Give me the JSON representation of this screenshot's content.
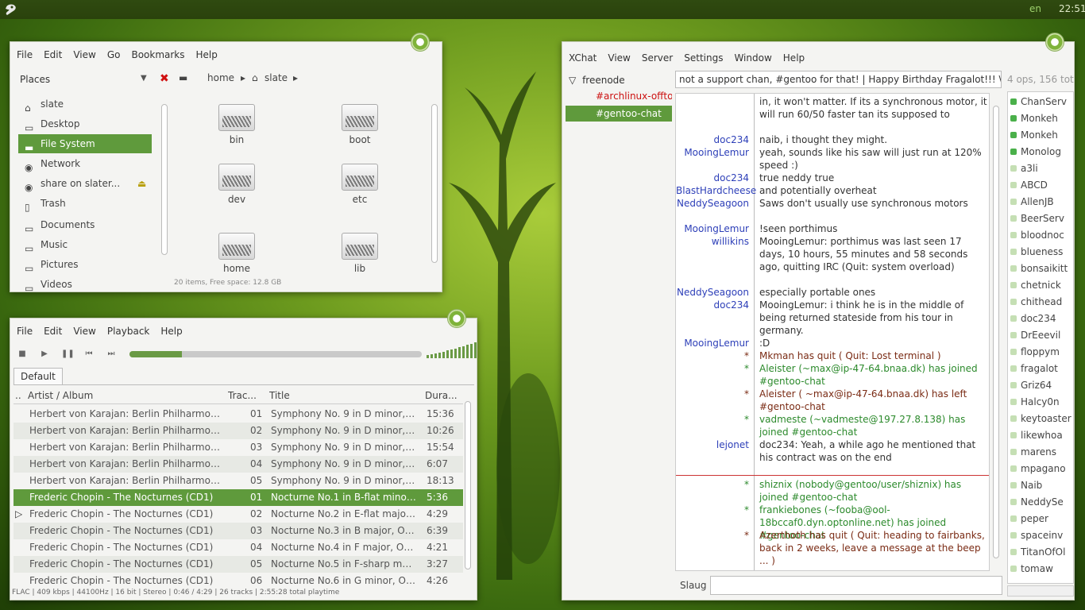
{
  "topbar": {
    "lang": "en",
    "clock": "22:51"
  },
  "file_manager": {
    "menu": [
      "File",
      "Edit",
      "View",
      "Go",
      "Bookmarks",
      "Help"
    ],
    "places_label": "Places",
    "places": [
      {
        "label": "slate",
        "icon": "home-icon"
      },
      {
        "label": "Desktop",
        "icon": "desktop-icon"
      },
      {
        "label": "File System",
        "icon": "drive-icon"
      },
      {
        "label": "Network",
        "icon": "network-icon"
      },
      {
        "label": "share on slater...",
        "icon": "network-share-icon"
      },
      {
        "label": "Trash",
        "icon": "trash-icon"
      },
      {
        "label": "Documents",
        "icon": "folder-icon"
      },
      {
        "label": "Music",
        "icon": "folder-icon"
      },
      {
        "label": "Pictures",
        "icon": "folder-icon"
      },
      {
        "label": "Videos",
        "icon": "folder-icon"
      }
    ],
    "breadcrumb": [
      "home",
      "slate"
    ],
    "folders": [
      "bin",
      "boot",
      "dev",
      "etc",
      "home",
      "lib"
    ],
    "status": "20 items, Free space: 12.8 GB"
  },
  "player": {
    "menu": [
      "File",
      "Edit",
      "View",
      "Playback",
      "Help"
    ],
    "progress": 0.18,
    "tab": "Default",
    "columns": {
      "artist": "Artist / Album",
      "track": "Trac...",
      "title": "Title",
      "duration": "Dura..."
    },
    "rows": [
      {
        "artist": "Herbert von Karajan: Berlin Philharmonic ...",
        "track": "01",
        "title": "Symphony No. 9 in D minor, O...",
        "duration": "15:36"
      },
      {
        "artist": "Herbert von Karajan: Berlin Philharmonic ...",
        "track": "02",
        "title": "Symphony No. 9 in D minor, O...",
        "duration": "10:26"
      },
      {
        "artist": "Herbert von Karajan: Berlin Philharmonic ...",
        "track": "03",
        "title": "Symphony No. 9 in D minor, O...",
        "duration": "15:54"
      },
      {
        "artist": "Herbert von Karajan: Berlin Philharmonic ...",
        "track": "04",
        "title": "Symphony No. 9 in D minor, O...",
        "duration": "6:07"
      },
      {
        "artist": "Herbert von Karajan: Berlin Philharmonic ...",
        "track": "05",
        "title": "Symphony No. 9 in D minor, O...",
        "duration": "18:13"
      },
      {
        "artist": "Frederic Chopin - The Nocturnes (CD1)",
        "track": "01",
        "title": "Nocturne No.1 in B-flat minor, ...",
        "duration": "5:36"
      },
      {
        "artist": "Frederic Chopin - The Nocturnes (CD1)",
        "track": "02",
        "title": "Nocturne No.2 in E-flat major, ...",
        "duration": "4:29"
      },
      {
        "artist": "Frederic Chopin - The Nocturnes (CD1)",
        "track": "03",
        "title": "Nocturne No.3 in B major, Op....",
        "duration": "6:39"
      },
      {
        "artist": "Frederic Chopin - The Nocturnes (CD1)",
        "track": "04",
        "title": "Nocturne No.4 in F major, Op....",
        "duration": "4:21"
      },
      {
        "artist": "Frederic Chopin - The Nocturnes (CD1)",
        "track": "05",
        "title": "Nocturne No.5 in F-sharp maj...",
        "duration": "3:27"
      },
      {
        "artist": "Frederic Chopin - The Nocturnes (CD1)",
        "track": "06",
        "title": "Nocturne No.6 in G minor, Op....",
        "duration": "4:26"
      }
    ],
    "status": "FLAC | 409 kbps | 44100Hz | 16 bit | Stereo | 0:46 / 4:29 | 26 tracks | 2:55:28 total playtime"
  },
  "xchat": {
    "menu": [
      "XChat",
      "View",
      "Server",
      "Settings",
      "Window",
      "Help"
    ],
    "network": "freenode",
    "channels": [
      "#archlinux-offto",
      "#gentoo-chat"
    ],
    "topic": "not a support chan, #gentoo for that!  | Happy Birthday Fragalot!!!  \\o/",
    "user_count": "4 ops, 156 tota",
    "messages": [
      {
        "nick": "",
        "text": "in, it won't matter.  If its  a synchronous motor, it will run 60/50 faster tan its supposed to",
        "style": "normal"
      },
      {
        "nick": "doc234",
        "text": "naib, i thought they might.",
        "style": "normal"
      },
      {
        "nick": "MooingLemur",
        "text": "yeah, sounds like his saw will just run at 120% speed :)",
        "style": "normal"
      },
      {
        "nick": "doc234",
        "text": "true neddy true",
        "style": "normal"
      },
      {
        "nick": "BlastHardcheese",
        "text": "  and potentially overheat",
        "style": "normal"
      },
      {
        "nick": "NeddySeagoon",
        "text": "Saws don't usually use synchronous motors",
        "style": "normal"
      },
      {
        "nick": "MooingLemur",
        "text": "!seen porthimus",
        "style": "normal"
      },
      {
        "nick": "willikins",
        "text": "MooingLemur: porthimus was last seen 17 days, 10 hours, 55 minutes and 58 seconds ago, quitting IRC (Quit: system overload)",
        "style": "normal"
      },
      {
        "nick": "NeddySeagoon",
        "text": "especially portable ones",
        "style": "normal"
      },
      {
        "nick": "doc234",
        "text": "MooingLemur: i think he is in the middle of being returned stateside from his tour in germany.",
        "style": "normal"
      },
      {
        "nick": "MooingLemur",
        "text": ":D",
        "style": "normal"
      },
      {
        "nick": "*",
        "text": "Mkman has quit (        Quit: Lost terminal     )",
        "style": "quit"
      },
      {
        "nick": "*",
        "text": "Aleister   (~max@ip-47-64.bnaa.dk) has joined #gentoo-chat",
        "style": "join"
      },
      {
        "nick": "*",
        "text": "Aleister (  ~max@ip-47-64.bnaa.dk) has left #gentoo-chat",
        "style": "quit"
      },
      {
        "nick": "*",
        "text": "vadmeste   (~vadmeste@197.27.8.138) has joined #gentoo-chat",
        "style": "join"
      },
      {
        "nick": "lejonet",
        "text": "doc234: Yeah, a while ago he mentioned that his contract was on the end",
        "style": "normal"
      },
      {
        "nick": "*",
        "text": "shiznix   (nobody@gentoo/user/shiznix) has joined #gentoo-chat",
        "style": "join"
      },
      {
        "nick": "*",
        "text": "frankiebones   (~fooba@ool-18bccaf0.dyn.optonline.net) has joined #gentoo-chat",
        "style": "join"
      },
      {
        "nick": "*",
        "text": "Azerthoth has quit (       Quit: heading to fairbanks, back in 2 weeks, leave a message at the beep ...        )",
        "style": "quit"
      }
    ],
    "users": [
      {
        "name": "ChanServ",
        "op": true
      },
      {
        "name": "Monkeh",
        "op": true
      },
      {
        "name": "Monkeh",
        "op": true
      },
      {
        "name": "Monolog",
        "op": true
      },
      {
        "name": "a3li",
        "op": false
      },
      {
        "name": "ABCD",
        "op": false
      },
      {
        "name": "AllenJB",
        "op": false
      },
      {
        "name": "BeerServ",
        "op": false
      },
      {
        "name": "bloodnoc",
        "op": false
      },
      {
        "name": "blueness",
        "op": false
      },
      {
        "name": "bonsaikitt",
        "op": false
      },
      {
        "name": "chetnick",
        "op": false
      },
      {
        "name": "chithead",
        "op": false
      },
      {
        "name": "doc234",
        "op": false
      },
      {
        "name": "DrEeevil",
        "op": false
      },
      {
        "name": "floppym",
        "op": false
      },
      {
        "name": "fragalot",
        "op": false
      },
      {
        "name": "Griz64",
        "op": false
      },
      {
        "name": "Halcy0n",
        "op": false
      },
      {
        "name": "keytoaster",
        "op": false
      },
      {
        "name": "likewhoa",
        "op": false
      },
      {
        "name": "marens",
        "op": false
      },
      {
        "name": "mpagano",
        "op": false
      },
      {
        "name": "Naib",
        "op": false
      },
      {
        "name": "NeddySe",
        "op": false
      },
      {
        "name": "peper",
        "op": false
      },
      {
        "name": "spaceinv",
        "op": false
      },
      {
        "name": "TitanOfOl",
        "op": false
      },
      {
        "name": "tomaw",
        "op": false
      }
    ],
    "nickname": "Slaug"
  }
}
